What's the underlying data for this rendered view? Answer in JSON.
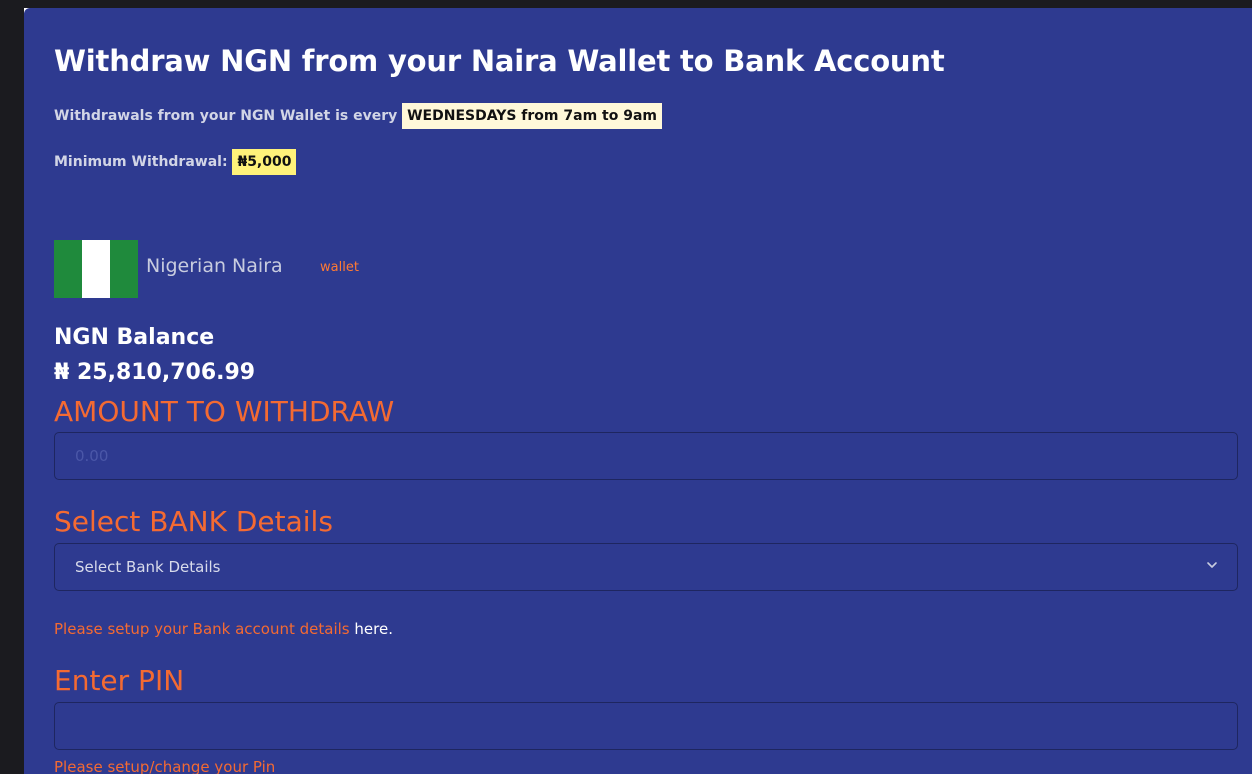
{
  "header": {
    "title": "Withdraw NGN from your Naira Wallet to Bank Account"
  },
  "notices": {
    "schedule_prefix": "Withdrawals from your NGN Wallet is every",
    "schedule_highlight": "WEDNESDAYS from 7am to 9am",
    "minimum_label": "Minimum Withdrawal:",
    "minimum_value": "₦5,000"
  },
  "wallet": {
    "flag_icon": "nigeria-flag-icon",
    "name": "Nigerian Naira",
    "tag": "wallet",
    "balance_label": "NGN Balance",
    "balance_value": "₦ 25,810,706.99"
  },
  "amount": {
    "label": "AMOUNT TO WITHDRAW",
    "placeholder": "0.00",
    "value": ""
  },
  "bank": {
    "label": "Select BANK Details",
    "selected": "Select Bank Details",
    "hint_text": "Please setup your Bank account details",
    "hint_link": "here."
  },
  "pin": {
    "label": "Enter PIN",
    "value": "",
    "hint_text": "Please setup/change your Pin"
  },
  "colors": {
    "panel_bg": "#2e3a90",
    "accent": "#f46a32",
    "highlight_bg": "#fff8d9",
    "highlight_yellow": "#fff27a"
  }
}
